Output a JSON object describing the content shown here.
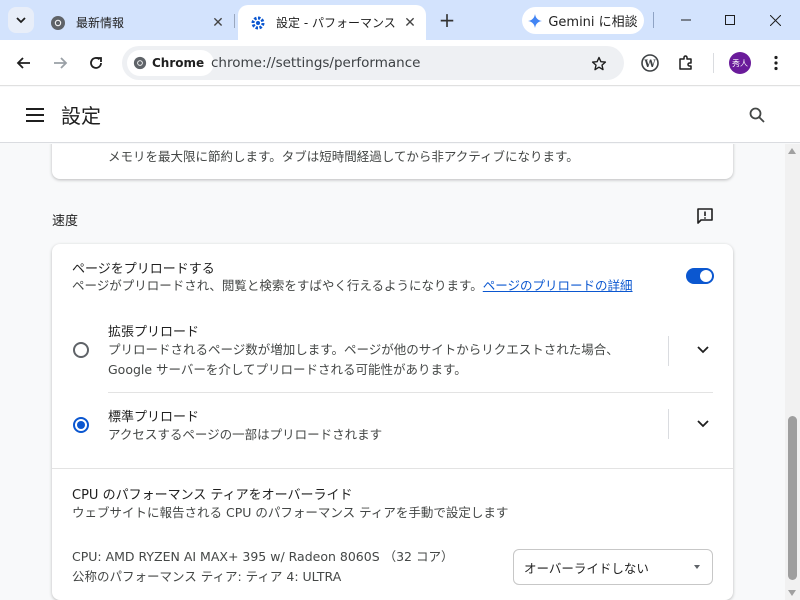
{
  "tabs": [
    {
      "title": "最新情報",
      "active": false
    },
    {
      "title": "設定 - パフォーマンス",
      "active": true
    }
  ],
  "gemini_label": "Gemini に相談",
  "omnibox": {
    "chip_label": "Chrome",
    "url": "chrome://settings/performance"
  },
  "profile": {
    "avatar_text": "秀人"
  },
  "settings": {
    "title": "設定"
  },
  "top_option": {
    "description": "メモリを最大限に節約します。タブは短時間経過してから非アクティブになります。"
  },
  "speed_section": {
    "title": "速度",
    "preload": {
      "label": "ページをプリロードする",
      "description": "ページがプリロードされ、閲覧と検索をすばやく行えるようになります。",
      "link": "ページのプリロードの詳細",
      "enabled": true
    },
    "options": [
      {
        "label": "拡張プリロード",
        "description_line1": "プリロードされるページ数が増加します。ページが他のサイトからリクエストされた場合、",
        "description_line2": "Google サーバーを介してプリロードされる可能性があります。",
        "selected": false
      },
      {
        "label": "標準プリロード",
        "description_line1": "アクセスするページの一部はプリロードされます",
        "selected": true
      }
    ],
    "cpu": {
      "label": "CPU のパフォーマンス ティアをオーバーライド",
      "description": "ウェブサイトに報告される CPU のパフォーマンス ティアを手動で設定します",
      "cpu_info": "CPU: AMD RYZEN AI MAX+ 395 w/ Radeon 8060S （32 コア）",
      "tier_info": "公称のパフォーマンス ティア: ティア 4: ULTRA",
      "select_value": "オーバーライドしない"
    }
  },
  "colors": {
    "accent": "#0b57d0",
    "tabstrip": "#d3e3fd"
  }
}
